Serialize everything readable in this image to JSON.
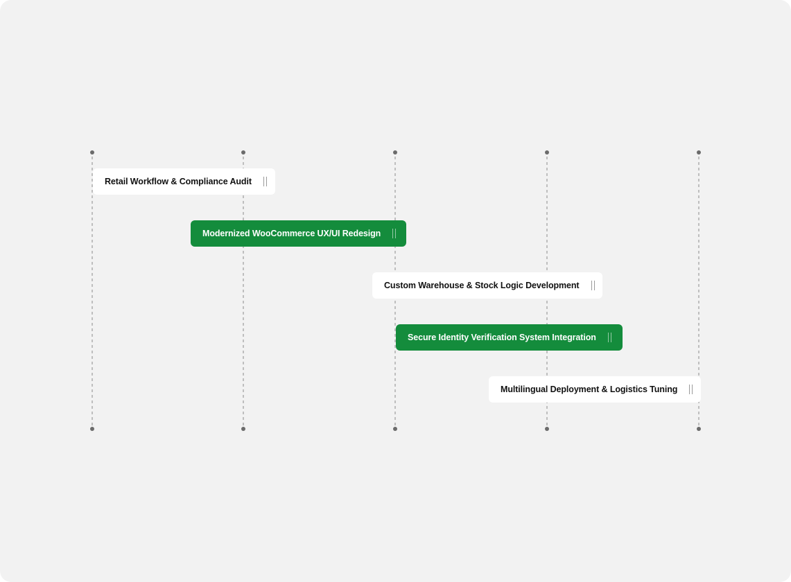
{
  "colors": {
    "background": "#f2f2f2",
    "task_light": "#ffffff",
    "task_accent": "#148c3c",
    "guide": "#8a8a8a"
  },
  "tasks": [
    {
      "label": "Retail Workflow & Compliance Audit",
      "style": "light",
      "icon": "drag-handle-icon"
    },
    {
      "label": "Modernized WooCommerce UX/UI Redesign",
      "style": "accent",
      "icon": "drag-handle-icon"
    },
    {
      "label": "Custom Warehouse & Stock Logic Development",
      "style": "light",
      "icon": "drag-handle-icon"
    },
    {
      "label": "Secure Identity Verification System Integration",
      "style": "accent",
      "icon": "drag-handle-icon"
    },
    {
      "label": "Multilingual Deployment & Logistics Tuning",
      "style": "light",
      "icon": "drag-handle-icon"
    }
  ]
}
